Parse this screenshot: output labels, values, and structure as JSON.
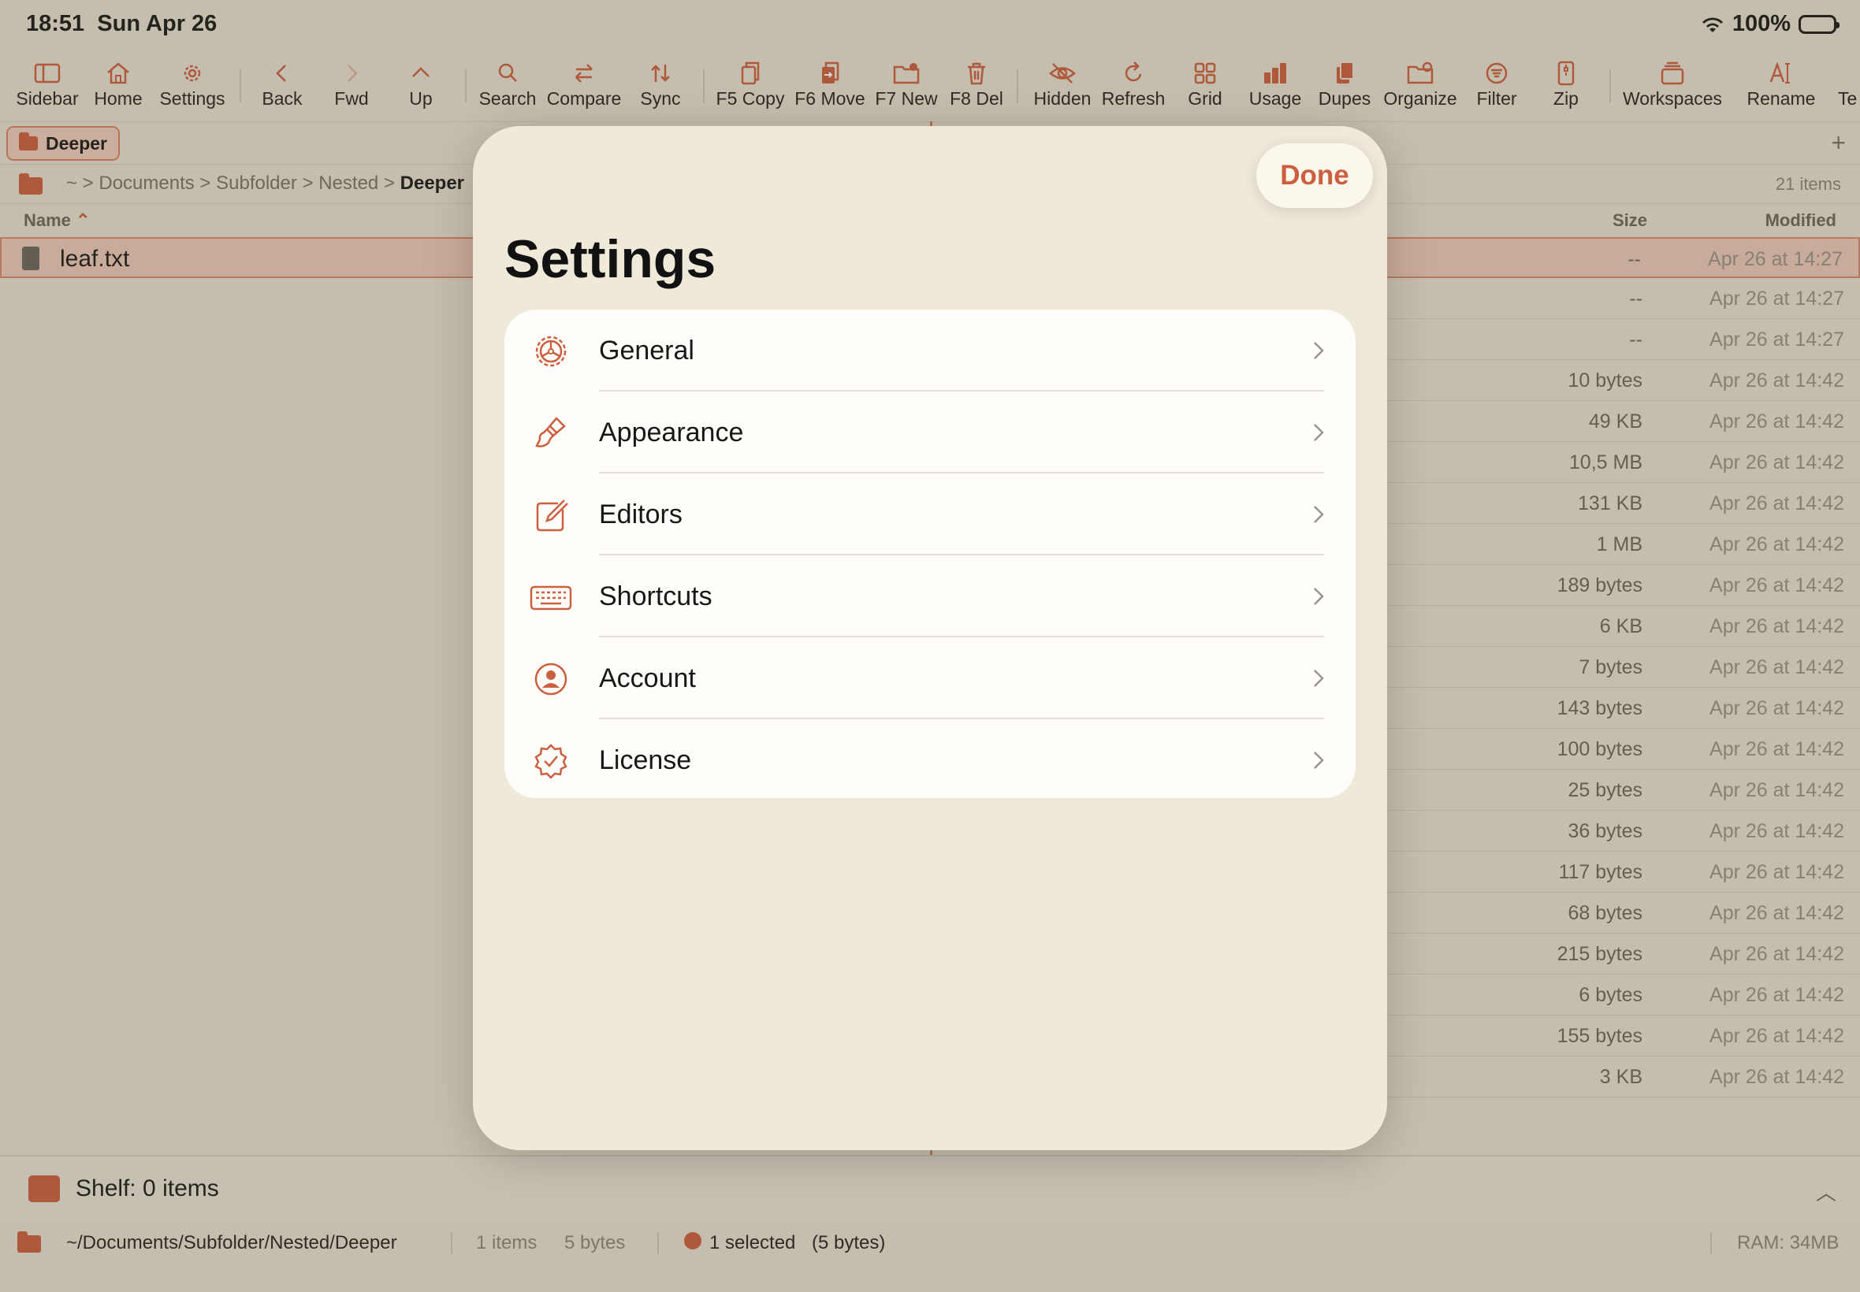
{
  "status_bar": {
    "time": "18:51",
    "date": "Sun Apr 26",
    "battery": "100%"
  },
  "toolbar": [
    {
      "label": "Sidebar",
      "icon": "sidebar-icon"
    },
    {
      "label": "Home",
      "icon": "home-icon"
    },
    {
      "label": "Settings",
      "icon": "gear-icon"
    },
    {
      "label": "Back",
      "icon": "chevron-left-icon"
    },
    {
      "label": "Fwd",
      "icon": "chevron-right-icon"
    },
    {
      "label": "Up",
      "icon": "chevron-up-icon"
    },
    {
      "label": "Search",
      "icon": "search-icon"
    },
    {
      "label": "Compare",
      "icon": "compare-arrows-icon"
    },
    {
      "label": "Sync",
      "icon": "sync-icon"
    },
    {
      "label": "F5 Copy",
      "icon": "copy-icon"
    },
    {
      "label": "F6 Move",
      "icon": "move-icon"
    },
    {
      "label": "F7 New",
      "icon": "new-folder-icon"
    },
    {
      "label": "F8 Del",
      "icon": "trash-icon"
    },
    {
      "label": "Hidden",
      "icon": "eye-slash-icon"
    },
    {
      "label": "Refresh",
      "icon": "refresh-icon"
    },
    {
      "label": "Grid",
      "icon": "grid-icon"
    },
    {
      "label": "Usage",
      "icon": "bar-chart-icon"
    },
    {
      "label": "Dupes",
      "icon": "duplicate-icon"
    },
    {
      "label": "Organize",
      "icon": "organize-folder-icon"
    },
    {
      "label": "Filter",
      "icon": "filter-icon"
    },
    {
      "label": "Zip",
      "icon": "zip-icon"
    },
    {
      "label": "Workspaces",
      "icon": "workspaces-icon"
    },
    {
      "label": "Rename",
      "icon": "rename-icon"
    },
    {
      "label": "Te",
      "icon": "terminal-icon"
    }
  ],
  "tab": {
    "label": "Deeper"
  },
  "path": {
    "root": "~",
    "parts": [
      "Documents",
      "Subfolder",
      "Nested"
    ],
    "current": "Deeper",
    "count": "21 items"
  },
  "columns": {
    "name": "Name",
    "size": "Size",
    "modified": "Modified"
  },
  "left_file": {
    "name": "leaf.txt"
  },
  "files": [
    {
      "size": "--",
      "modified": "Apr 26 at 14:27"
    },
    {
      "size": "--",
      "modified": "Apr 26 at 14:27"
    },
    {
      "size": "--",
      "modified": "Apr 26 at 14:27"
    },
    {
      "size": "10 bytes",
      "modified": "Apr 26 at 14:42"
    },
    {
      "size": "49 KB",
      "modified": "Apr 26 at 14:42"
    },
    {
      "size": "10,5 MB",
      "modified": "Apr 26 at 14:42"
    },
    {
      "size": "131 KB",
      "modified": "Apr 26 at 14:42"
    },
    {
      "size": "1 MB",
      "modified": "Apr 26 at 14:42"
    },
    {
      "size": "189 bytes",
      "modified": "Apr 26 at 14:42"
    },
    {
      "size": "6 KB",
      "modified": "Apr 26 at 14:42"
    },
    {
      "size": "7 bytes",
      "modified": "Apr 26 at 14:42"
    },
    {
      "size": "143 bytes",
      "modified": "Apr 26 at 14:42"
    },
    {
      "size": "100 bytes",
      "modified": "Apr 26 at 14:42"
    },
    {
      "size": "25 bytes",
      "modified": "Apr 26 at 14:42"
    },
    {
      "size": "36 bytes",
      "modified": "Apr 26 at 14:42"
    },
    {
      "size": "117 bytes",
      "modified": "Apr 26 at 14:42"
    },
    {
      "size": "68 bytes",
      "modified": "Apr 26 at 14:42"
    },
    {
      "size": "215 bytes",
      "modified": "Apr 26 at 14:42"
    },
    {
      "size": "6 bytes",
      "modified": "Apr 26 at 14:42"
    },
    {
      "size": "155 bytes",
      "modified": "Apr 26 at 14:42"
    },
    {
      "size": "3 KB",
      "modified": "Apr 26 at 14:42"
    }
  ],
  "shelf": {
    "label": "Shelf: 0 items"
  },
  "footer": {
    "path": "~/Documents/Subfolder/Nested/Deeper",
    "items": "1 items",
    "bytes": "5 bytes",
    "selected": "1 selected",
    "selected_size": "(5 bytes)",
    "ram": "RAM: 34MB"
  },
  "settings": {
    "title": "Settings",
    "done_label": "Done",
    "items": [
      {
        "label": "General",
        "icon": "gear-wheel-icon"
      },
      {
        "label": "Appearance",
        "icon": "paintbrush-icon"
      },
      {
        "label": "Editors",
        "icon": "edit-square-icon"
      },
      {
        "label": "Shortcuts",
        "icon": "keyboard-icon"
      },
      {
        "label": "Account",
        "icon": "person-circle-icon"
      },
      {
        "label": "License",
        "icon": "checkmark-seal-icon"
      }
    ]
  },
  "colors": {
    "accent": "#cc5f3f",
    "background": "#e9e2d1",
    "sheet": "#efe9da",
    "list": "#fefdfa"
  }
}
